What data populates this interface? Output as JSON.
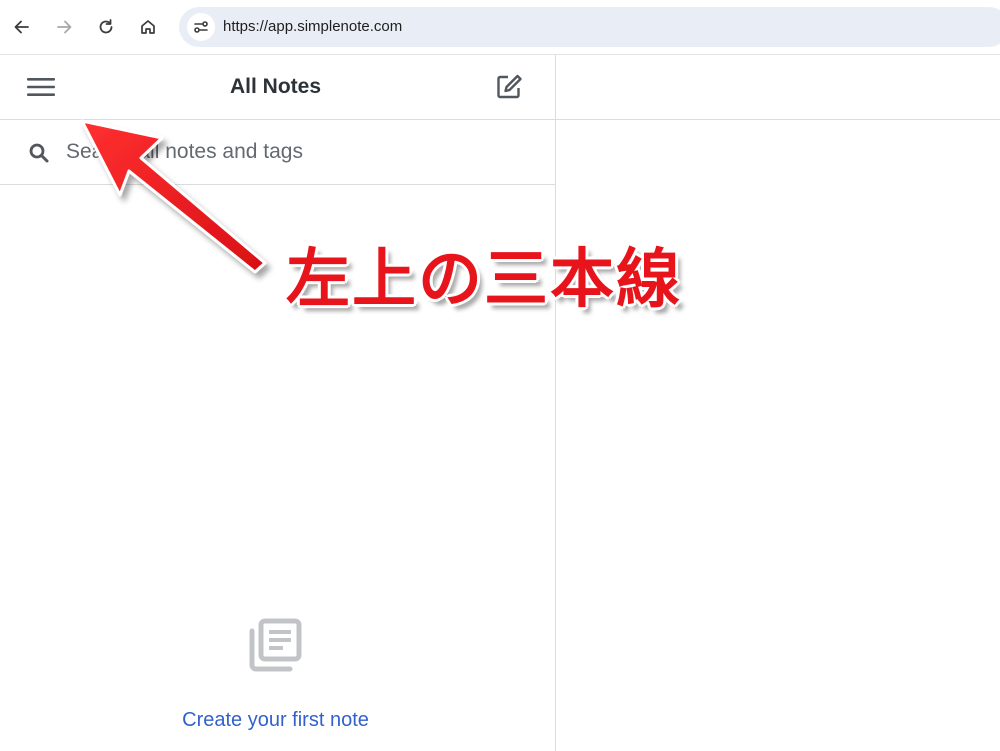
{
  "browser": {
    "url": "https://app.simplenote.com",
    "icons": {
      "back": "arrow-left-icon",
      "forward": "arrow-right-icon",
      "reload": "reload-icon",
      "home": "home-icon",
      "site_info": "tune-icon"
    }
  },
  "sidebar": {
    "title": "All Notes",
    "search": {
      "placeholder": "Search all notes and tags",
      "value": ""
    },
    "empty_state": {
      "link_label": "Create your first note"
    }
  },
  "annotation": {
    "text": "左上の三本線",
    "color": "#e8141c"
  },
  "colors": {
    "link": "#3361cc",
    "divider": "#dcdcde",
    "address_bar": "#e9eef6"
  }
}
